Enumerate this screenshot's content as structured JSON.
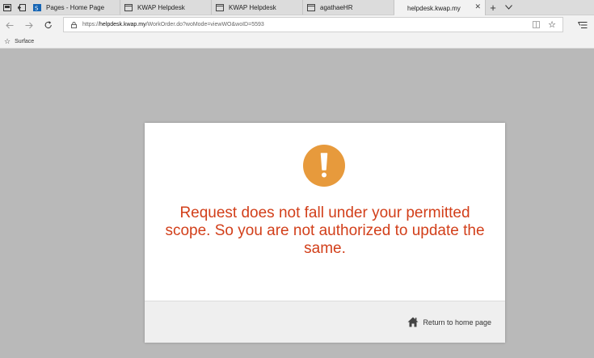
{
  "tabs": [
    {
      "label": "Pages - Home Page",
      "icon": "sharepoint-icon",
      "active": false
    },
    {
      "label": "KWAP Helpdesk",
      "icon": "page-icon",
      "active": false
    },
    {
      "label": "KWAP Helpdesk",
      "icon": "page-icon",
      "active": false
    },
    {
      "label": "agathaeHR",
      "icon": "page-icon",
      "active": false
    },
    {
      "label": "helpdesk.kwap.my",
      "icon": "",
      "active": true,
      "close": "✕"
    }
  ],
  "tabbar": {
    "new_tab": "+"
  },
  "address": {
    "scheme": "https://",
    "host": "helpdesk.kwap.my",
    "path": "/WorkOrder.do?woMode=viewWO&woID=5593"
  },
  "favorites": {
    "items": [
      "Surface"
    ]
  },
  "dialog": {
    "message": "Request does not fall under your permitted scope. So you are not authorized to update the same.",
    "home_link": "Return to home page"
  },
  "colors": {
    "message": "#d23f1a",
    "alert_icon": "#e79a3c",
    "page_bg": "#b9b9b9"
  }
}
